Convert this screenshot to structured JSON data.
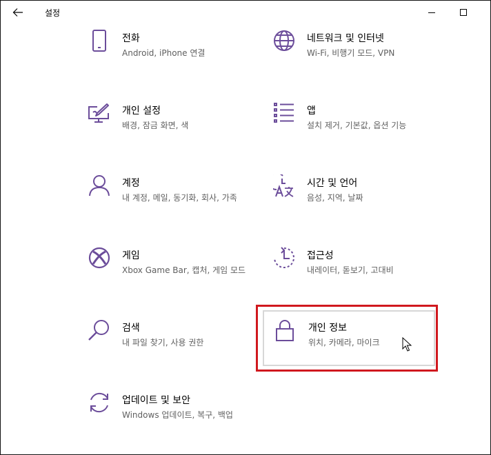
{
  "window": {
    "title": "설정"
  },
  "items": [
    {
      "key": "phone",
      "label": "전화",
      "desc": "Android, iPhone 연결",
      "icon": "phone-icon"
    },
    {
      "key": "network",
      "label": "네트워크 및 인터넷",
      "desc": "Wi-Fi, 비행기 모드, VPN",
      "icon": "globe-icon"
    },
    {
      "key": "personalization",
      "label": "개인 설정",
      "desc": "배경, 잠금 화면, 색",
      "icon": "paintbrush-monitor-icon"
    },
    {
      "key": "apps",
      "label": "앱",
      "desc": "설치 제거, 기본값, 옵션 기능",
      "icon": "app-list-icon"
    },
    {
      "key": "accounts",
      "label": "계정",
      "desc": "내 계정, 메일, 동기화, 회사, 가족",
      "icon": "person-icon"
    },
    {
      "key": "time",
      "label": "시간 및 언어",
      "desc": "음성, 지역, 날짜",
      "icon": "time-language-icon"
    },
    {
      "key": "gaming",
      "label": "게임",
      "desc": "Xbox Game Bar, 캡처, 게임 모드",
      "icon": "xbox-icon"
    },
    {
      "key": "accessibility",
      "label": "접근성",
      "desc": "내레이터, 돋보기, 고대비",
      "icon": "accessibility-icon"
    },
    {
      "key": "search",
      "label": "검색",
      "desc": "내 파일 찾기, 사용 권한",
      "icon": "search-icon"
    },
    {
      "key": "privacy",
      "label": "개인 정보",
      "desc": "위치, 카메라, 마이크",
      "icon": "lock-icon"
    },
    {
      "key": "update",
      "label": "업데이트 및 보안",
      "desc": "Windows 업데이트, 복구, 백업",
      "icon": "sync-arrows-icon"
    }
  ],
  "colors": {
    "accent": "#6b4c9a",
    "highlight": "#d0181e",
    "desc_text": "#5f5f5f"
  },
  "hovered_item": "privacy"
}
